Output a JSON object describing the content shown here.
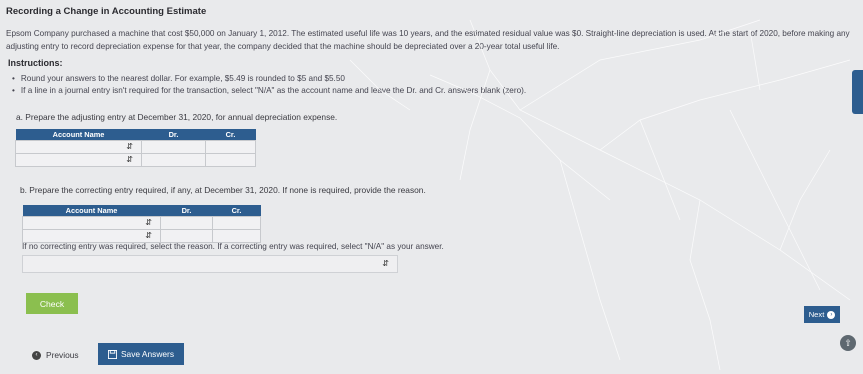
{
  "title": "Recording a Change in Accounting Estimate",
  "intro": "Epsom Company purchased a machine that cost $50,000 on January 1, 2012. The estimated useful life was 10 years, and the estimated residual value was $0. Straight-line depreciation is used. At the start of 2020, before making any adjusting entry to record depreciation expense for that year, the company decided that the machine should be depreciated over a 20-year total useful life.",
  "instructions": {
    "heading": "Instructions:",
    "items": [
      "Round your answers to the nearest dollar. For example, $5.49 is rounded to $5 and $5.50",
      "If a line in a journal entry isn't required for the transaction, select \"N/A\" as the account name and leave the Dr. and Cr. answers blank (zero)."
    ]
  },
  "part_a": {
    "prompt": "a. Prepare the adjusting entry at December 31, 2020, for annual depreciation expense.",
    "headers": [
      "Account Name",
      "Dr.",
      "Cr."
    ]
  },
  "part_b": {
    "prompt": "b. Prepare the correcting entry required, if any, at December 31, 2020. If none is required, provide the reason.",
    "headers": [
      "Account Name",
      "Dr.",
      "Cr."
    ]
  },
  "reason_label": "If no correcting entry was required, select the reason. If a correcting entry was required, select \"N/A\" as your answer.",
  "buttons": {
    "check": "Check",
    "previous": "Previous",
    "save": "Save Answers",
    "next": "Next"
  },
  "icons": {
    "select_arrow": "up-down-arrows-icon",
    "previous": "chevron-left-circle-icon",
    "save": "save-icon",
    "next": "chevron-right-circle-icon",
    "fab": "up-arrow-circle-icon"
  },
  "colors": {
    "header_blue": "#2d5d8f",
    "check_green": "#8bbf4f",
    "background": "#e9eaec"
  }
}
